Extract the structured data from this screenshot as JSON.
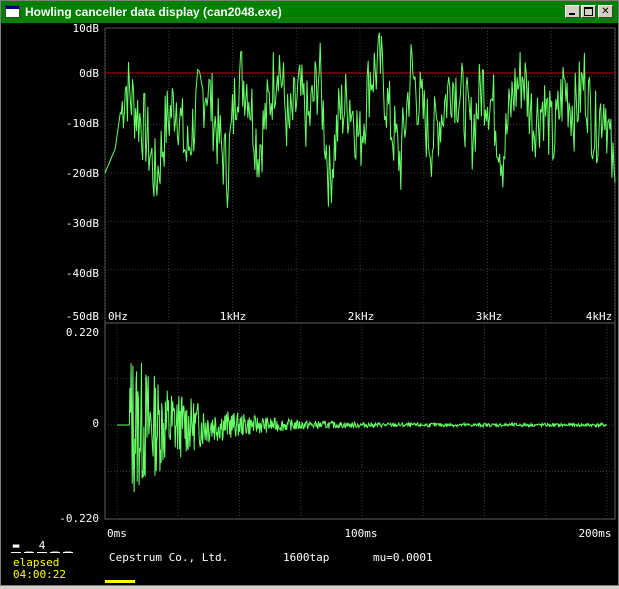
{
  "window": {
    "title": "Howling canceller data display (can2048.exe)",
    "titlebar_color": "#008000",
    "buttons": [
      "minimize-icon",
      "maximize-icon",
      "close-icon"
    ]
  },
  "spectrum_panel": {
    "y_tick_labels": [
      "10dB",
      "0dB",
      "-10dB",
      "-20dB",
      "-30dB",
      "-40dB",
      "-50dB"
    ],
    "x_tick_labels": [
      "0Hz",
      "1kHz",
      "2kHz",
      "3kHz",
      "4kHz"
    ],
    "trace_color": "#66ff66",
    "reference_line_color": "#c00000"
  },
  "impulse_panel": {
    "y_tick_labels": [
      "0.220",
      "0",
      "-0.220"
    ],
    "x_tick_labels": [
      "0ms",
      "100ms",
      "200ms"
    ],
    "trace_color": "#66ff66"
  },
  "chart_data": [
    {
      "type": "line",
      "y_unit": "dB",
      "ylim": [
        -50,
        10
      ],
      "xlim_hz": [
        0,
        4000
      ],
      "reference_line_db": 0,
      "grid": true,
      "series": [
        {
          "x_hz": [
            0,
            80,
            160,
            240,
            320,
            400,
            480,
            560,
            640,
            720,
            800,
            880,
            960,
            1040,
            1120,
            1200,
            1280,
            1360,
            1440,
            1520,
            1600,
            1680,
            1760,
            1840,
            1920,
            2000,
            2080,
            2160,
            2240,
            2320,
            2400,
            2480,
            2560,
            2640,
            2720,
            2800,
            2880,
            2960,
            3040,
            3120,
            3200,
            3280,
            3360,
            3440,
            3520,
            3600,
            3680,
            3760,
            3840,
            3920,
            4000
          ],
          "y_db": [
            -20,
            -15,
            0,
            -5,
            -10,
            -20,
            -8,
            -3,
            -15,
            -5,
            0,
            -10,
            -18,
            2,
            0,
            -14,
            -5,
            6,
            -10,
            -2,
            -8,
            3,
            -20,
            -6,
            -3,
            -12,
            2,
            4,
            -8,
            -16,
            3,
            -5,
            -12,
            -6,
            1,
            -3,
            -10,
            0,
            -4,
            -15,
            -2,
            2,
            -8,
            -4,
            -12,
            0,
            -6,
            1,
            -10,
            -3,
            -22
          ]
        }
      ]
    },
    {
      "type": "line",
      "ylim": [
        -0.22,
        0.22
      ],
      "xlim_ms": [
        0,
        200
      ],
      "grid": true,
      "series": [
        {
          "envelope": "decaying impulse response, onset near 5ms, peak near 0.19, decays to near 0 by ~150ms"
        }
      ]
    }
  ],
  "status": {
    "channel_boxes": [
      "▬",
      "_",
      "4",
      "_",
      "_"
    ],
    "elapsed_label": "elapsed",
    "elapsed_time": "04:00:22",
    "company": "Cepstrum Co., Ltd.",
    "taps": "1600tap",
    "mu": "mu=0.0001",
    "accent_color": "#ffff00"
  }
}
